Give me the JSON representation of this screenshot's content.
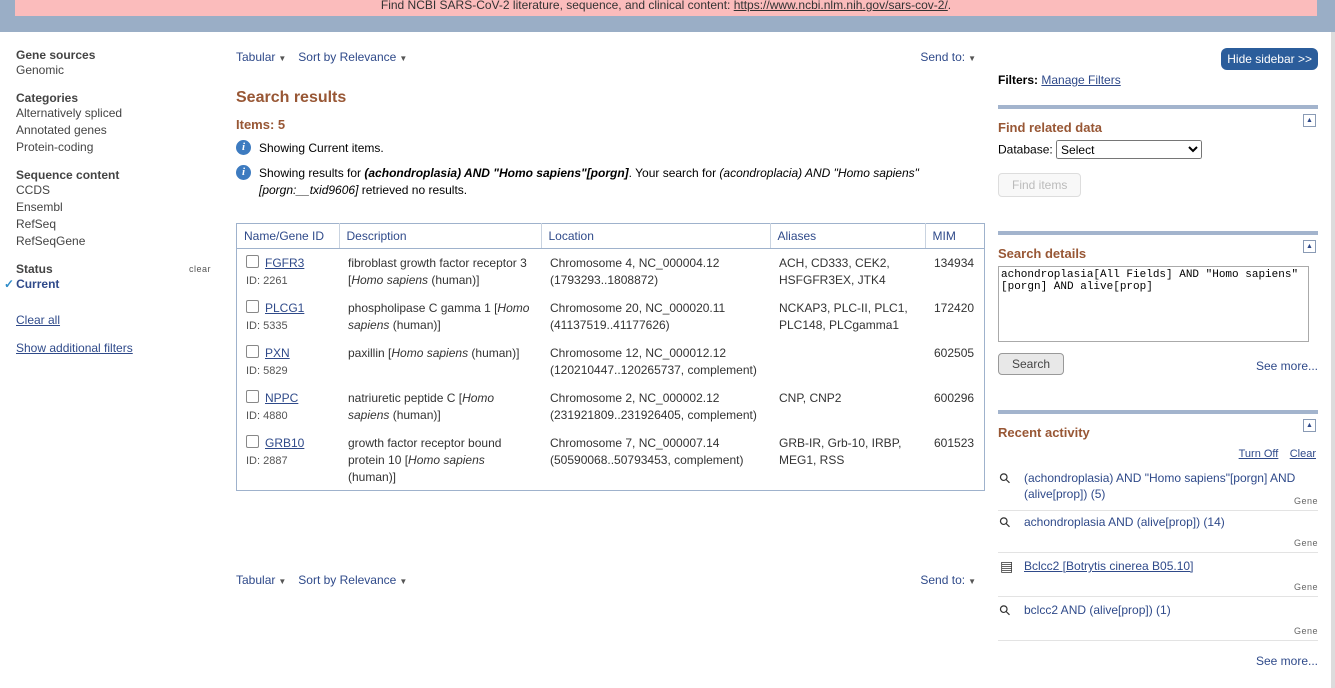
{
  "banner": {
    "text": "Find NCBI SARS-CoV-2 literature, sequence, and clinical content: ",
    "link": "https://www.ncbi.nlm.nih.gov/sars-cov-2/",
    "tail": "."
  },
  "sidebar": {
    "groups": [
      {
        "title": "Gene sources",
        "items": [
          "Genomic"
        ]
      },
      {
        "title": "Categories",
        "items": [
          "Alternatively spliced",
          "Annotated genes",
          "Protein-coding"
        ]
      },
      {
        "title": "Sequence content",
        "items": [
          "CCDS",
          "Ensembl",
          "RefSeq",
          "RefSeqGene"
        ]
      }
    ],
    "status_title": "Status",
    "status_clear": "clear",
    "status_current": "Current",
    "clear_all": "Clear all",
    "show_additional": "Show additional filters"
  },
  "toolbar": {
    "format": "Tabular",
    "sort": "Sort by Relevance",
    "send": "Send to:"
  },
  "results": {
    "title": "Search results",
    "items": "Items: 5",
    "msg1": "Showing Current items.",
    "msg2_prefix": "Showing results for ",
    "msg2_query": "(achondroplasia) AND \"Homo sapiens\"[porgn]",
    "msg2_mid": ". Your search for ",
    "msg2_orig": "(acondroplacia) AND \"Homo sapiens\" [porgn:__txid9606]",
    "msg2_suffix": " retrieved no results."
  },
  "table": {
    "headers": [
      "Name/Gene ID",
      "Description",
      "Location",
      "Aliases",
      "MIM"
    ],
    "rows": [
      {
        "name": "FGFR3",
        "id": "ID: 2261",
        "desc": "fibroblast growth factor receptor 3 [",
        "species": "Homo sapiens",
        "desc_tail": " (human)]",
        "loc": "Chromosome 4, NC_000004.12 (1793293..1808872)",
        "aliases": "ACH, CD333, CEK2, HSFGFR3EX, JTK4",
        "mim": "134934"
      },
      {
        "name": "PLCG1",
        "id": "ID: 5335",
        "desc": "phospholipase C gamma 1 [",
        "species": "Homo sapiens",
        "desc_tail": " (human)]",
        "loc": "Chromosome 20, NC_000020.11 (41137519..41177626)",
        "aliases": "NCKAP3, PLC-II, PLC1, PLC148, PLCgamma1",
        "mim": "172420"
      },
      {
        "name": "PXN",
        "id": "ID: 5829",
        "desc": "paxillin [",
        "species": "Homo sapiens",
        "desc_tail": " (human)]",
        "loc": "Chromosome 12, NC_000012.12 (120210447..120265737, complement)",
        "aliases": "",
        "mim": "602505"
      },
      {
        "name": "NPPC",
        "id": "ID: 4880",
        "desc": "natriuretic peptide C [",
        "species": "Homo sapiens",
        "desc_tail": " (human)]",
        "loc": "Chromosome 2, NC_000002.12 (231921809..231926405, complement)",
        "aliases": "CNP, CNP2",
        "mim": "600296"
      },
      {
        "name": "GRB10",
        "id": "ID: 2887",
        "desc": "growth factor receptor bound protein 10 [",
        "species": "Homo sapiens",
        "desc_tail": " (human)]",
        "loc": "Chromosome 7, NC_000007.14 (50590068..50793453, complement)",
        "aliases": "GRB-IR, Grb-10, IRBP, MEG1, RSS",
        "mim": "601523"
      }
    ]
  },
  "right": {
    "hide_sidebar": "Hide sidebar >>",
    "filters_label": "Filters:",
    "manage_filters": "Manage Filters",
    "find_related": "Find related data",
    "database_label": "Database:",
    "database_value": "Select",
    "find_items": "Find items",
    "search_details": "Search details",
    "query": "achondroplasia[All Fields] AND \"Homo sapiens\"[porgn] AND alive[prop]",
    "search_btn": "Search",
    "see_more": "See more...",
    "recent_activity": "Recent activity",
    "turn_off": "Turn Off",
    "clear": "Clear",
    "activity": [
      {
        "icon": "search-icon",
        "text": "(achondroplasia) AND \"Homo sapiens\"[porgn] AND (alive[prop]) (5)",
        "db": "Gene"
      },
      {
        "icon": "search-icon",
        "text": "achondroplasia AND (alive[prop]) (14)",
        "db": "Gene"
      },
      {
        "icon": "document-icon",
        "text": "Bclcc2 [Botrytis cinerea B05.10]",
        "db": "Gene"
      },
      {
        "icon": "search-icon",
        "text": "bclcc2 AND (alive[prop]) (1)",
        "db": "Gene"
      }
    ],
    "see_more_bottom": "See more..."
  }
}
